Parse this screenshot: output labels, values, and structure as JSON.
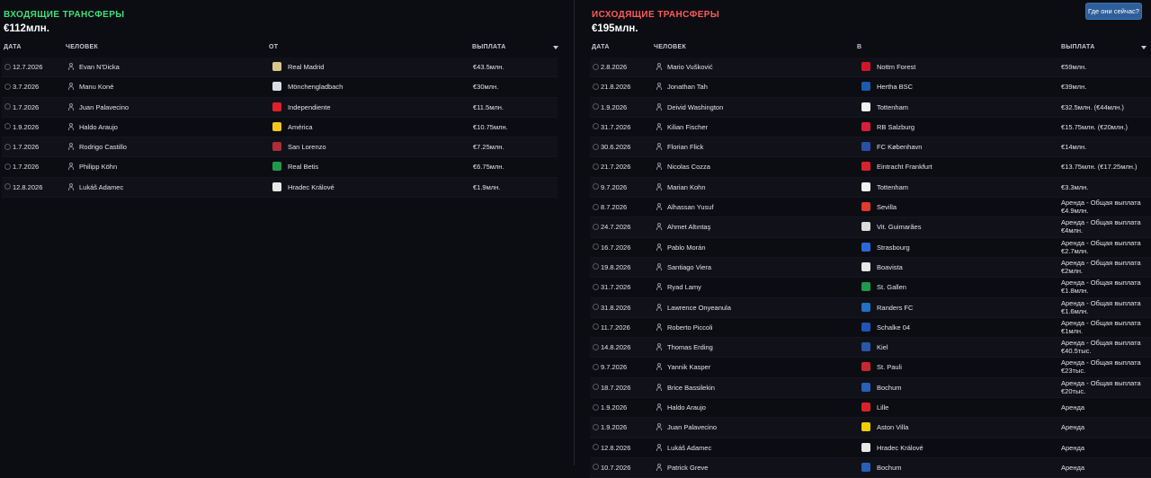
{
  "incoming": {
    "title": "ВХОДЯЩИЕ ТРАНСФЕРЫ",
    "total": "€112млн.",
    "headers": {
      "date": "ДАТА",
      "person": "ЧЕЛОВЕК",
      "club": "ОТ",
      "fee": "ВЫПЛАТА"
    },
    "rows": [
      {
        "date": "12.7.2026",
        "name": "Evan N'Dicka",
        "club": "Real Madrid",
        "fee": "€43.5млн.",
        "crest": "#d8c98a"
      },
      {
        "date": "3.7.2026",
        "name": "Manu Koné",
        "club": "Mönchengladbach",
        "fee": "€30млн.",
        "crest": "#d9dde3"
      },
      {
        "date": "1.7.2026",
        "name": "Juan Palavecino",
        "club": "Independiente",
        "fee": "€11.5млн.",
        "crest": "#e0202a"
      },
      {
        "date": "1.9.2026",
        "name": "Haldo Araujo",
        "club": "América",
        "fee": "€10.75млн.",
        "crest": "#f2c71a"
      },
      {
        "date": "1.7.2026",
        "name": "Rodrigo Castillo",
        "club": "San Lorenzo",
        "fee": "€7.25млн.",
        "crest": "#b32b3a"
      },
      {
        "date": "1.7.2026",
        "name": "Philipp Köhn",
        "club": "Real Betis",
        "fee": "€6.75млн.",
        "crest": "#1f9a4b"
      },
      {
        "date": "12.8.2026",
        "name": "Lukáš Adamec",
        "club": "Hradec Králové",
        "fee": "€1.9млн.",
        "crest": "#e8e8e8"
      }
    ]
  },
  "outgoing": {
    "title": "ИСХОДЯЩИЕ ТРАНСФЕРЫ",
    "total": "€195млн.",
    "headers": {
      "date": "ДАТА",
      "person": "ЧЕЛОВЕК",
      "club": "В",
      "fee": "ВЫПЛАТА"
    },
    "rows": [
      {
        "date": "2.8.2026",
        "name": "Mario Vušković",
        "club": "Nottm Forest",
        "fee": "€59млн.",
        "crest": "#d3172a"
      },
      {
        "date": "21.8.2026",
        "name": "Jonathan Tah",
        "club": "Hertha BSC",
        "fee": "€39млн.",
        "crest": "#1b5bb0"
      },
      {
        "date": "1.9.2026",
        "name": "Deivid Washington",
        "club": "Tottenham",
        "fee": "€32.5млн. (€44млн.)",
        "crest": "#f0f0f0"
      },
      {
        "date": "31.7.2026",
        "name": "Kilian Fischer",
        "club": "RB Salzburg",
        "fee": "€15.75млн. (€20млн.)",
        "crest": "#d81e3a"
      },
      {
        "date": "30.6.2026",
        "name": "Florian Flick",
        "club": "FC København",
        "fee": "€14млн.",
        "crest": "#2a4fa8"
      },
      {
        "date": "21.7.2026",
        "name": "Nicolas Cozza",
        "club": "Eintracht Frankfurt",
        "fee": "€13.75млн. (€17.25млн.)",
        "crest": "#d8232a"
      },
      {
        "date": "9.7.2026",
        "name": "Marian Kohn",
        "club": "Tottenham",
        "fee": "€3.3млн.",
        "crest": "#f0f0f0"
      },
      {
        "date": "8.7.2026",
        "name": "Alhassan Yusuf",
        "club": "Sevilla",
        "fee": "Аренда - Общая выплата €4.9млн.",
        "crest": "#e23a2e"
      },
      {
        "date": "24.7.2026",
        "name": "Ahmet Altıntaş",
        "club": "Vit. Guimarães",
        "fee": "Аренда - Общая выплата €4млн.",
        "crest": "#dcdcdc"
      },
      {
        "date": "16.7.2026",
        "name": "Pablo Morán",
        "club": "Strasbourg",
        "fee": "Аренда - Общая выплата €2.7млн.",
        "crest": "#2b6ad6"
      },
      {
        "date": "19.8.2026",
        "name": "Santiago Viera",
        "club": "Boavista",
        "fee": "Аренда - Общая выплата €2млн.",
        "crest": "#e6e6e6"
      },
      {
        "date": "31.7.2026",
        "name": "Ryad Lamy",
        "club": "St. Gallen",
        "fee": "Аренда - Общая выплата €1.8млн.",
        "crest": "#1d9a4a"
      },
      {
        "date": "31.8.2026",
        "name": "Lawrence Onyeanula",
        "club": "Randers FC",
        "fee": "Аренда - Общая выплата €1.6млн.",
        "crest": "#2270c9"
      },
      {
        "date": "11.7.2026",
        "name": "Roberto Piccoli",
        "club": "Schalke 04",
        "fee": "Аренда - Общая выплата €1млн.",
        "crest": "#1e56b8"
      },
      {
        "date": "14.8.2026",
        "name": "Thomas Erding",
        "club": "Kiel",
        "fee": "Аренда - Общая выплата €40.5тыс.",
        "crest": "#2a56a8"
      },
      {
        "date": "9.7.2026",
        "name": "Yannik Kasper",
        "club": "St. Pauli",
        "fee": "Аренда - Общая выплата €23тыс.",
        "crest": "#c8282d"
      },
      {
        "date": "18.7.2026",
        "name": "Brice Bassilekin",
        "club": "Bochum",
        "fee": "Аренда - Общая выплата €20тыс.",
        "crest": "#2a5fb8"
      },
      {
        "date": "1.9.2026",
        "name": "Haldo Araujo",
        "club": "Lille",
        "fee": "Аренда",
        "crest": "#d8232a"
      },
      {
        "date": "1.9.2026",
        "name": "Juan Palavecino",
        "club": "Aston Villa",
        "fee": "Аренда",
        "crest": "#f0d000"
      },
      {
        "date": "12.8.2026",
        "name": "Lukáš Adamec",
        "club": "Hradec Králové",
        "fee": "Аренда",
        "crest": "#e8e8e8"
      },
      {
        "date": "10.7.2026",
        "name": "Patrick Greve",
        "club": "Bochum",
        "fee": "Аренда",
        "crest": "#2a5fb8"
      }
    ]
  },
  "help_button": "Где они сейчас?"
}
